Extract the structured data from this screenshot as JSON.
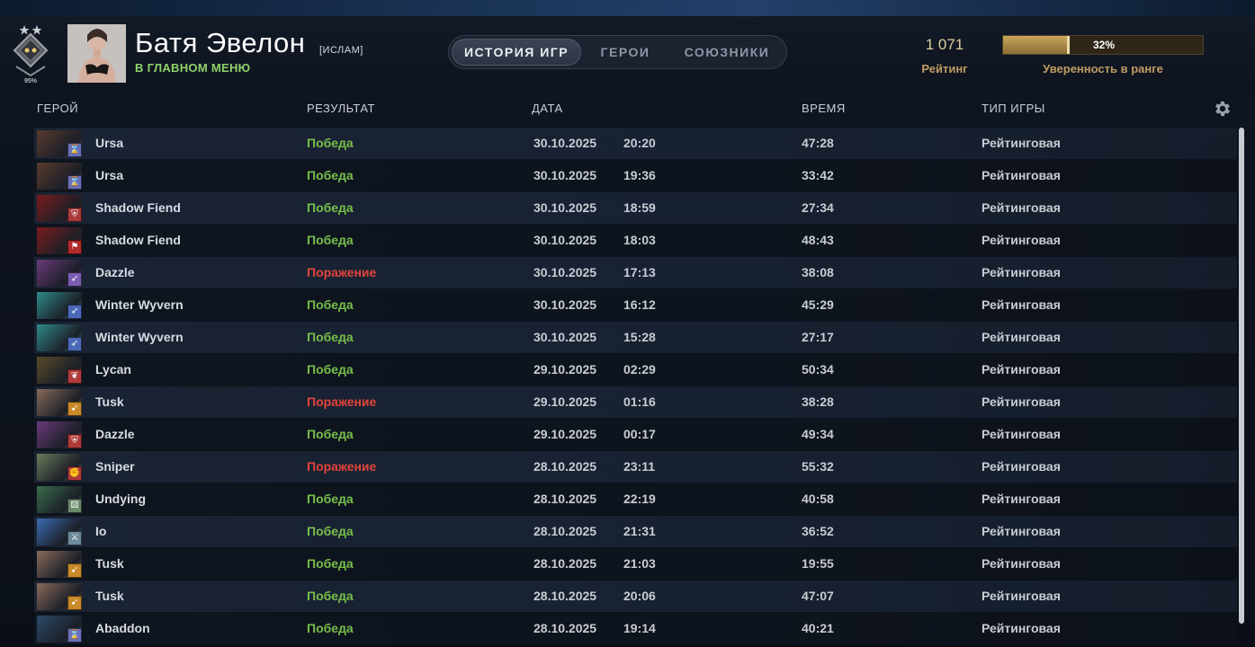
{
  "profile": {
    "rank_percent": "95%",
    "name": "Батя Эвелон",
    "tag": "[ИСЛАМ]",
    "status": "В ГЛАВНОМ МЕНЮ"
  },
  "tabs": [
    {
      "label": "ИСТОРИЯ ИГР",
      "active": true
    },
    {
      "label": "ГЕРОИ",
      "active": false
    },
    {
      "label": "СОЮЗНИКИ",
      "active": false
    }
  ],
  "rating": {
    "value": "1 071",
    "label": "Рейтинг",
    "confidence_text": "32%",
    "confidence_fraction": 0.32,
    "confidence_label": "Уверенность в ранге"
  },
  "table": {
    "headers": {
      "hero": "ГЕРОЙ",
      "result": "РЕЗУЛЬТАТ",
      "date": "ДАТА",
      "duration": "ВРЕМЯ",
      "game_type": "ТИП ИГРЫ"
    },
    "rows": [
      {
        "hero": "Ursa",
        "result": "Победа",
        "win": true,
        "date": "30.10.2025",
        "time": "20:20",
        "duration": "47:28",
        "type": "Рейтинговая",
        "hero_color": "#5a3a2e",
        "role_icon": "hourglass-icon",
        "role_color": "#6a6fb6"
      },
      {
        "hero": "Ursa",
        "result": "Победа",
        "win": true,
        "date": "30.10.2025",
        "time": "19:36",
        "duration": "33:42",
        "type": "Рейтинговая",
        "hero_color": "#5a3a2e",
        "role_icon": "hourglass-icon",
        "role_color": "#6a6fb6"
      },
      {
        "hero": "Shadow Fiend",
        "result": "Победа",
        "win": true,
        "date": "30.10.2025",
        "time": "18:59",
        "duration": "27:34",
        "type": "Рейтинговая",
        "hero_color": "#7a1c1c",
        "role_icon": "shield-icon",
        "role_color": "#a83a3a"
      },
      {
        "hero": "Shadow Fiend",
        "result": "Победа",
        "win": true,
        "date": "30.10.2025",
        "time": "18:03",
        "duration": "48:43",
        "type": "Рейтинговая",
        "hero_color": "#7a1c1c",
        "role_icon": "flag-icon",
        "role_color": "#b02a2a"
      },
      {
        "hero": "Dazzle",
        "result": "Поражение",
        "win": false,
        "date": "30.10.2025",
        "time": "17:13",
        "duration": "38:08",
        "type": "Рейтинговая",
        "hero_color": "#6b3a7a",
        "role_icon": "arrow-icon",
        "role_color": "#7a5cb0"
      },
      {
        "hero": "Winter Wyvern",
        "result": "Победа",
        "win": true,
        "date": "30.10.2025",
        "time": "16:12",
        "duration": "45:29",
        "type": "Рейтинговая",
        "hero_color": "#2f8a8a",
        "role_icon": "arrow-icon",
        "role_color": "#4a6ab8"
      },
      {
        "hero": "Winter Wyvern",
        "result": "Победа",
        "win": true,
        "date": "30.10.2025",
        "time": "15:28",
        "duration": "27:17",
        "type": "Рейтинговая",
        "hero_color": "#2f8a8a",
        "role_icon": "arrow-icon",
        "role_color": "#4a6ab8"
      },
      {
        "hero": "Lycan",
        "result": "Победа",
        "win": true,
        "date": "29.10.2025",
        "time": "02:29",
        "duration": "50:34",
        "type": "Рейтинговая",
        "hero_color": "#5a4a2a",
        "role_icon": "paw-icon",
        "role_color": "#b03a3a"
      },
      {
        "hero": "Tusk",
        "result": "Поражение",
        "win": false,
        "date": "29.10.2025",
        "time": "01:16",
        "duration": "38:28",
        "type": "Рейтинговая",
        "hero_color": "#8a6a5a",
        "role_icon": "runner-icon",
        "role_color": "#c98a2a"
      },
      {
        "hero": "Dazzle",
        "result": "Победа",
        "win": true,
        "date": "29.10.2025",
        "time": "00:17",
        "duration": "49:34",
        "type": "Рейтинговая",
        "hero_color": "#6b3a7a",
        "role_icon": "shield-icon",
        "role_color": "#b03a3a"
      },
      {
        "hero": "Sniper",
        "result": "Поражение",
        "win": false,
        "date": "28.10.2025",
        "time": "23:11",
        "duration": "55:32",
        "type": "Рейтинговая",
        "hero_color": "#6a7a5a",
        "role_icon": "fist-icon",
        "role_color": "#b03a3a"
      },
      {
        "hero": "Undying",
        "result": "Победа",
        "win": true,
        "date": "28.10.2025",
        "time": "22:19",
        "duration": "40:58",
        "type": "Рейтинговая",
        "hero_color": "#3a6a4a",
        "role_icon": "dice-icon",
        "role_color": "#6a8a6a"
      },
      {
        "hero": "Io",
        "result": "Победа",
        "win": true,
        "date": "28.10.2025",
        "time": "21:31",
        "duration": "36:52",
        "type": "Рейтинговая",
        "hero_color": "#3a6ab0",
        "role_icon": "sword-icon",
        "role_color": "#6a8a9a"
      },
      {
        "hero": "Tusk",
        "result": "Победа",
        "win": true,
        "date": "28.10.2025",
        "time": "21:03",
        "duration": "19:55",
        "type": "Рейтинговая",
        "hero_color": "#8a6a5a",
        "role_icon": "runner-icon",
        "role_color": "#c98a2a"
      },
      {
        "hero": "Tusk",
        "result": "Победа",
        "win": true,
        "date": "28.10.2025",
        "time": "20:06",
        "duration": "47:07",
        "type": "Рейтинговая",
        "hero_color": "#8a6a5a",
        "role_icon": "runner-icon",
        "role_color": "#c98a2a"
      },
      {
        "hero": "Abaddon",
        "result": "Победа",
        "win": true,
        "date": "28.10.2025",
        "time": "19:14",
        "duration": "40:21",
        "type": "Рейтинговая",
        "hero_color": "#2a4a6a",
        "role_icon": "hourglass-icon",
        "role_color": "#6a6fb6"
      }
    ]
  }
}
